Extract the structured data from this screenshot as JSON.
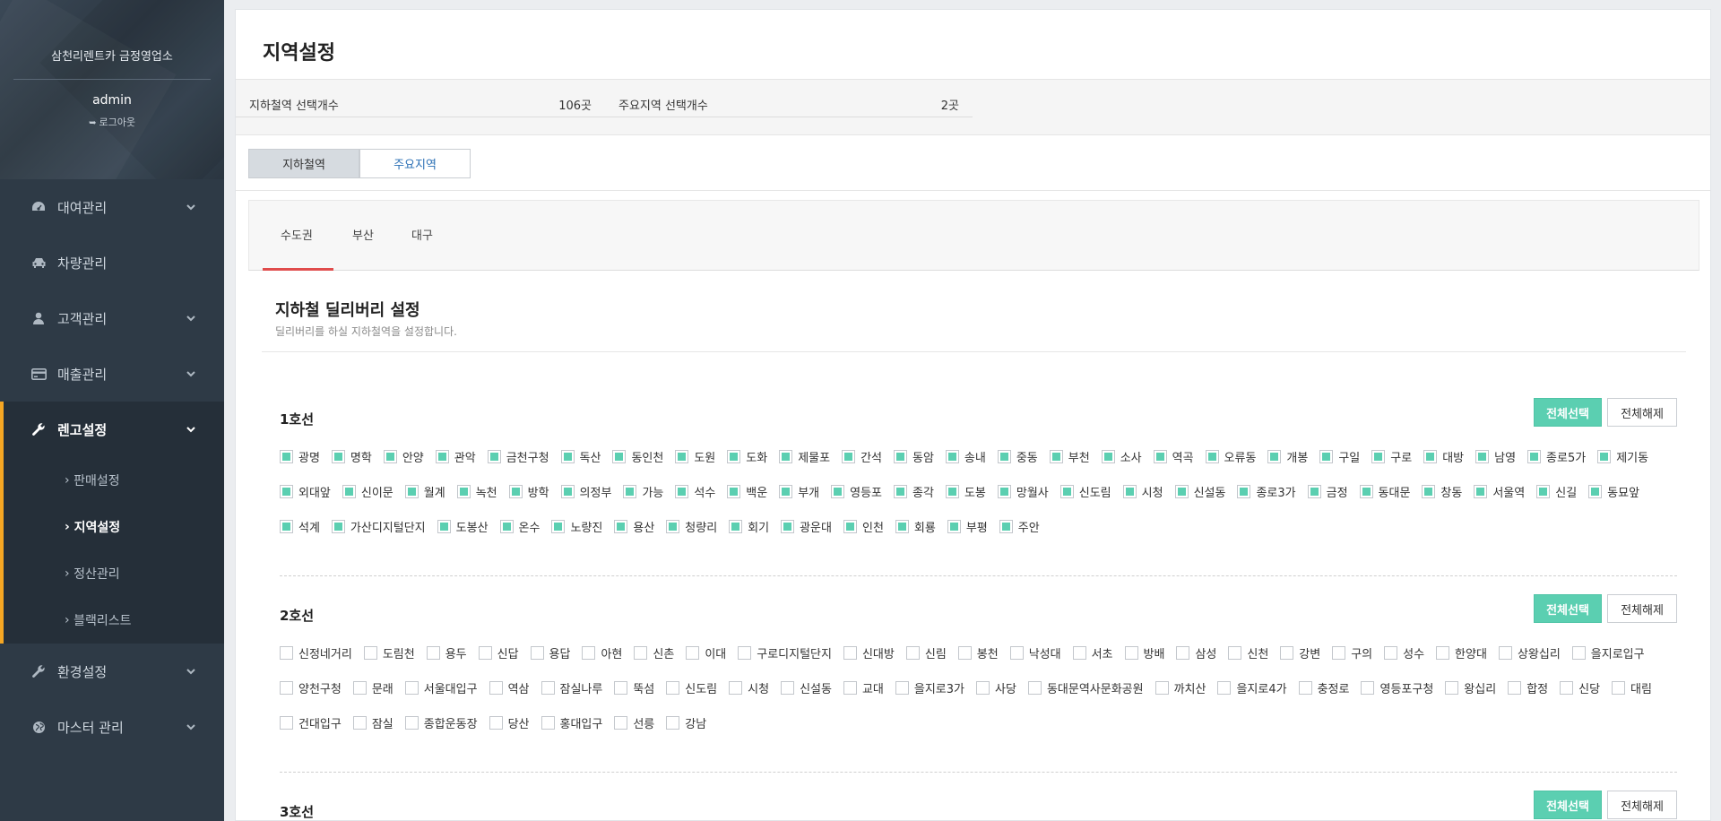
{
  "sidebar": {
    "company": "삼천리렌트카 금정영업소",
    "user": "admin",
    "logout": "로그아웃",
    "menu": [
      {
        "label": "대여관리"
      },
      {
        "label": "차량관리"
      },
      {
        "label": "고객관리"
      },
      {
        "label": "매출관리"
      },
      {
        "label": "렌고설정"
      },
      {
        "label": "환경설정"
      },
      {
        "label": "마스터 관리"
      }
    ],
    "submenu": [
      "판매설정",
      "지역설정",
      "정산관리",
      "블랙리스트"
    ]
  },
  "page": {
    "title": "지역설정",
    "summary": {
      "subway_label": "지하철역 선택개수",
      "subway_value": "106곳",
      "major_label": "주요지역 선택개수",
      "major_value": "2곳"
    },
    "toggle": [
      "지하철역",
      "주요지역"
    ],
    "region_tabs": [
      "수도권",
      "부산",
      "대구"
    ],
    "section_title": "지하철 딜리버리 설정",
    "section_desc": "딜리버리를 하실 지하철역을 설정합니다.",
    "select_all": "전체선택",
    "clear_all": "전체해제",
    "lines": [
      {
        "name": "1호선",
        "checked": true,
        "stations": [
          "광명",
          "명학",
          "안양",
          "관악",
          "금천구청",
          "독산",
          "동인천",
          "도원",
          "도화",
          "제물포",
          "간석",
          "동암",
          "송내",
          "중동",
          "부천",
          "소사",
          "역곡",
          "오류동",
          "개봉",
          "구일",
          "구로",
          "대방",
          "남영",
          "종로5가",
          "제기동",
          "외대앞",
          "신이문",
          "월계",
          "녹천",
          "방학",
          "의정부",
          "가능",
          "석수",
          "백운",
          "부개",
          "영등포",
          "종각",
          "도봉",
          "망월사",
          "신도림",
          "시청",
          "신설동",
          "종로3가",
          "금정",
          "동대문",
          "창동",
          "서울역",
          "신길",
          "동묘앞",
          "석계",
          "가산디지털단지",
          "도봉산",
          "온수",
          "노량진",
          "용산",
          "청량리",
          "회기",
          "광운대",
          "인천",
          "회룡",
          "부평",
          "주안"
        ]
      },
      {
        "name": "2호선",
        "checked": false,
        "stations": [
          "신정네거리",
          "도림천",
          "용두",
          "신답",
          "용답",
          "아현",
          "신촌",
          "이대",
          "구로디지털단지",
          "신대방",
          "신림",
          "봉천",
          "낙성대",
          "서초",
          "방배",
          "삼성",
          "신천",
          "강변",
          "구의",
          "성수",
          "한양대",
          "상왕십리",
          "을지로입구",
          "양천구청",
          "문래",
          "서울대입구",
          "역삼",
          "잠실나루",
          "뚝섬",
          "신도림",
          "시청",
          "신설동",
          "교대",
          "을지로3가",
          "사당",
          "동대문역사문화공원",
          "까치산",
          "을지로4가",
          "충정로",
          "영등포구청",
          "왕십리",
          "합정",
          "신당",
          "대림",
          "건대입구",
          "잠실",
          "종합운동장",
          "당산",
          "홍대입구",
          "선릉",
          "강남"
        ]
      },
      {
        "name": "3호선",
        "checked": false,
        "stations": []
      }
    ]
  },
  "colors": {
    "sidebar_bg": "#2e3a46",
    "accent_orange": "#f5a623",
    "accent_green": "#5bcfb1",
    "tab_underline": "#e04c4c",
    "link_blue": "#2a6fb5"
  }
}
